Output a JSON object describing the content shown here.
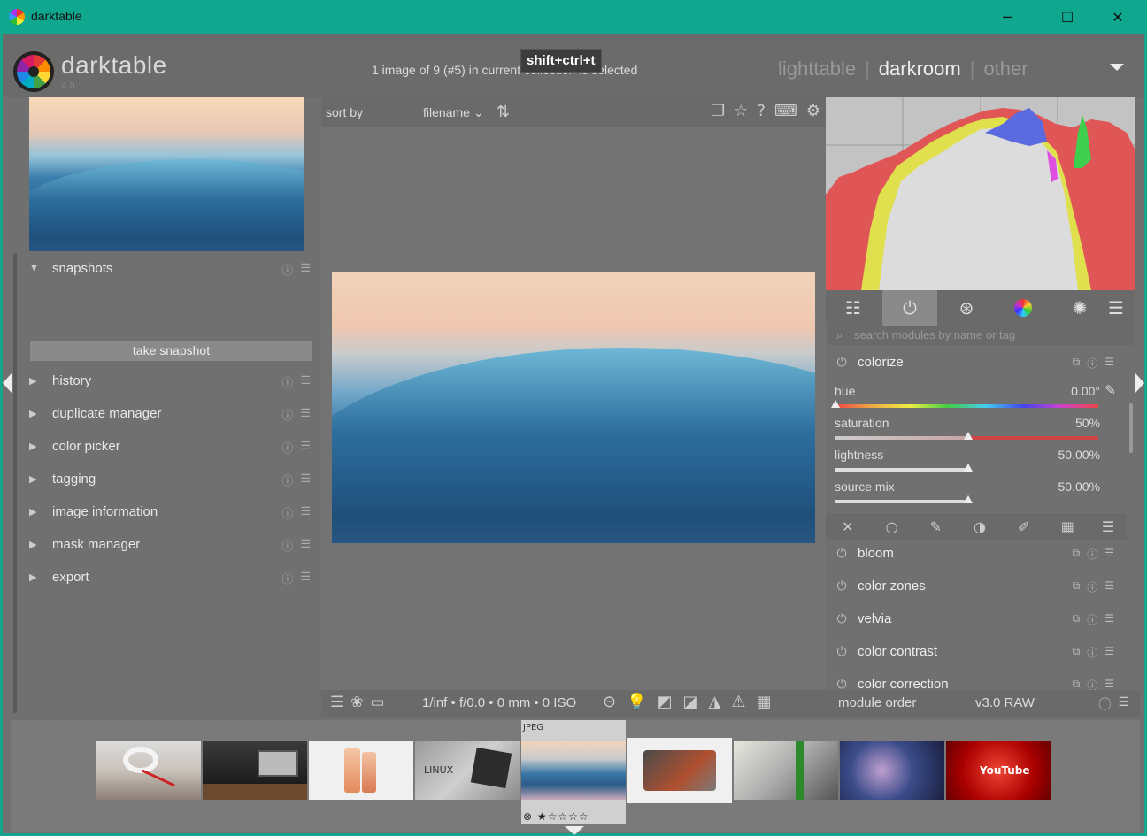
{
  "window": {
    "title": "darktable",
    "minimize": "─",
    "maximize": "☐",
    "close": "✕"
  },
  "header": {
    "logo_text": "darktable",
    "version": "4.0.1",
    "image_info": "1 image of 9 (#5) in current collection is selected",
    "tooltip": "shift+ctrl+t",
    "views": [
      "lighttable",
      "darkroom",
      "other"
    ],
    "active_view": "darkroom"
  },
  "left_panel": {
    "sections": [
      {
        "label": "snapshots",
        "expanded": true
      },
      {
        "label": "history"
      },
      {
        "label": "duplicate manager"
      },
      {
        "label": "color picker"
      },
      {
        "label": "tagging"
      },
      {
        "label": "image information"
      },
      {
        "label": "mask manager"
      },
      {
        "label": "export"
      }
    ],
    "take_snapshot": "take snapshot"
  },
  "center": {
    "sort_label": "sort by",
    "sort_value": "filename",
    "sort_arrow": "⌄"
  },
  "right_panel": {
    "search_placeholder": "search modules by name or tag",
    "colorize": {
      "title": "colorize",
      "sliders": [
        {
          "label": "hue",
          "value": "0.00°",
          "level": 0.0
        },
        {
          "label": "saturation",
          "value": "50%",
          "level": 0.5
        },
        {
          "label": "lightness",
          "value": "50.00%",
          "level": 0.5
        },
        {
          "label": "source mix",
          "value": "50.00%",
          "level": 0.5
        }
      ]
    },
    "modules": [
      "bloom",
      "color zones",
      "velvia",
      "color contrast",
      "color correction"
    ]
  },
  "bottom_bar": {
    "exif": "1/inf • f/0.0 • 0 mm • 0 ISO",
    "module_order_label": "module order",
    "module_order_value": "v3.0 RAW"
  },
  "filmstrip": {
    "selected_label": "JPEG",
    "selected_stars": "⊗ ★☆☆☆☆"
  },
  "colors": {
    "titlebar": "#0fa88f",
    "panel": "#707070",
    "accent_red": "#e0545a"
  }
}
